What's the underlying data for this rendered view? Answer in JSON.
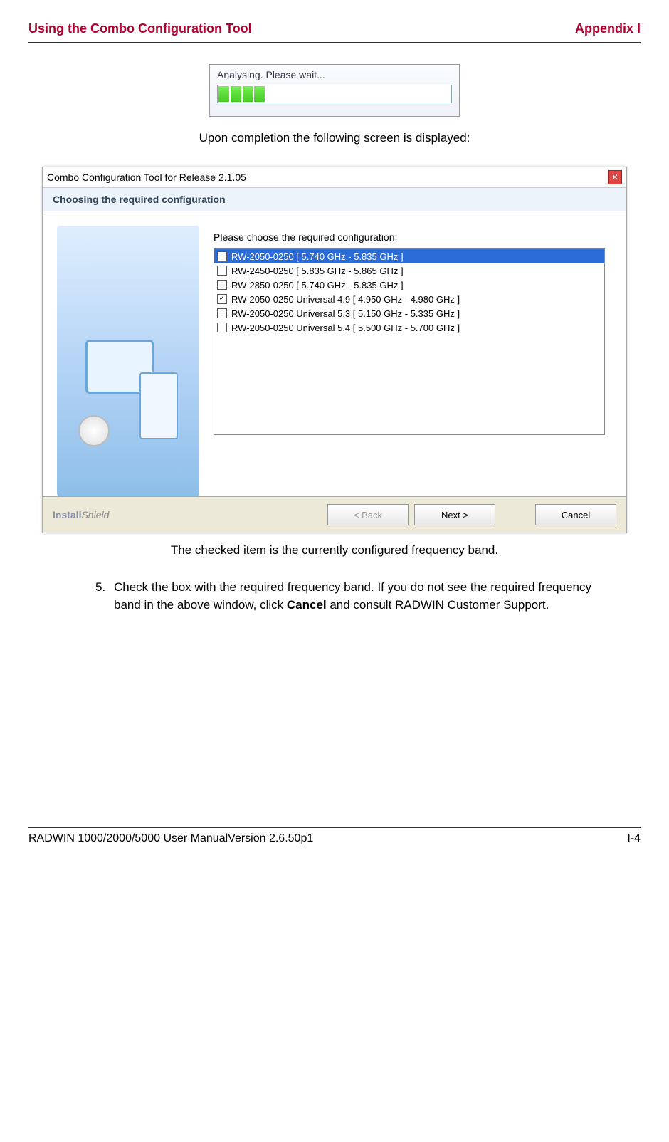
{
  "header": {
    "left": "Using the Combo Configuration Tool",
    "right": "Appendix I"
  },
  "analysing_dialog": {
    "text": "Analysing. Please wait..."
  },
  "captions": {
    "after_progress": "Upon completion the following screen is displayed:",
    "checked_note": "The checked item is the currently configured frequency band."
  },
  "installer": {
    "title": "Combo Configuration Tool for Release 2.1.05",
    "subhead": "Choosing the required configuration",
    "instruction": "Please choose the required configuration:",
    "items": [
      {
        "label": "RW-2050-0250 [ 5.740 GHz - 5.835 GHz ]",
        "checked": false,
        "selected": true
      },
      {
        "label": "RW-2450-0250 [ 5.835 GHz - 5.865 GHz ]",
        "checked": false,
        "selected": false
      },
      {
        "label": "RW-2850-0250 [ 5.740 GHz - 5.835 GHz ]",
        "checked": false,
        "selected": false
      },
      {
        "label": "RW-2050-0250 Universal 4.9 [ 4.950 GHz - 4.980 GHz ]",
        "checked": true,
        "selected": false
      },
      {
        "label": "RW-2050-0250 Universal 5.3 [ 5.150 GHz - 5.335 GHz ]",
        "checked": false,
        "selected": false
      },
      {
        "label": "RW-2050-0250 Universal 5.4 [ 5.500 GHz - 5.700 GHz ]",
        "checked": false,
        "selected": false
      }
    ],
    "branding": "InstallShield",
    "buttons": {
      "back": "< Back",
      "next": "Next >",
      "cancel": "Cancel"
    }
  },
  "step5": {
    "num": "5.",
    "p1": "Check the box with the required frequency band. If you do not see the required frequency band in the above window, click ",
    "bold": "Cancel",
    "p2": " and consult RADWIN Customer Support."
  },
  "footer": {
    "left": "RADWIN 1000/2000/5000 User ManualVersion  2.6.50p1",
    "right": "I-4"
  }
}
